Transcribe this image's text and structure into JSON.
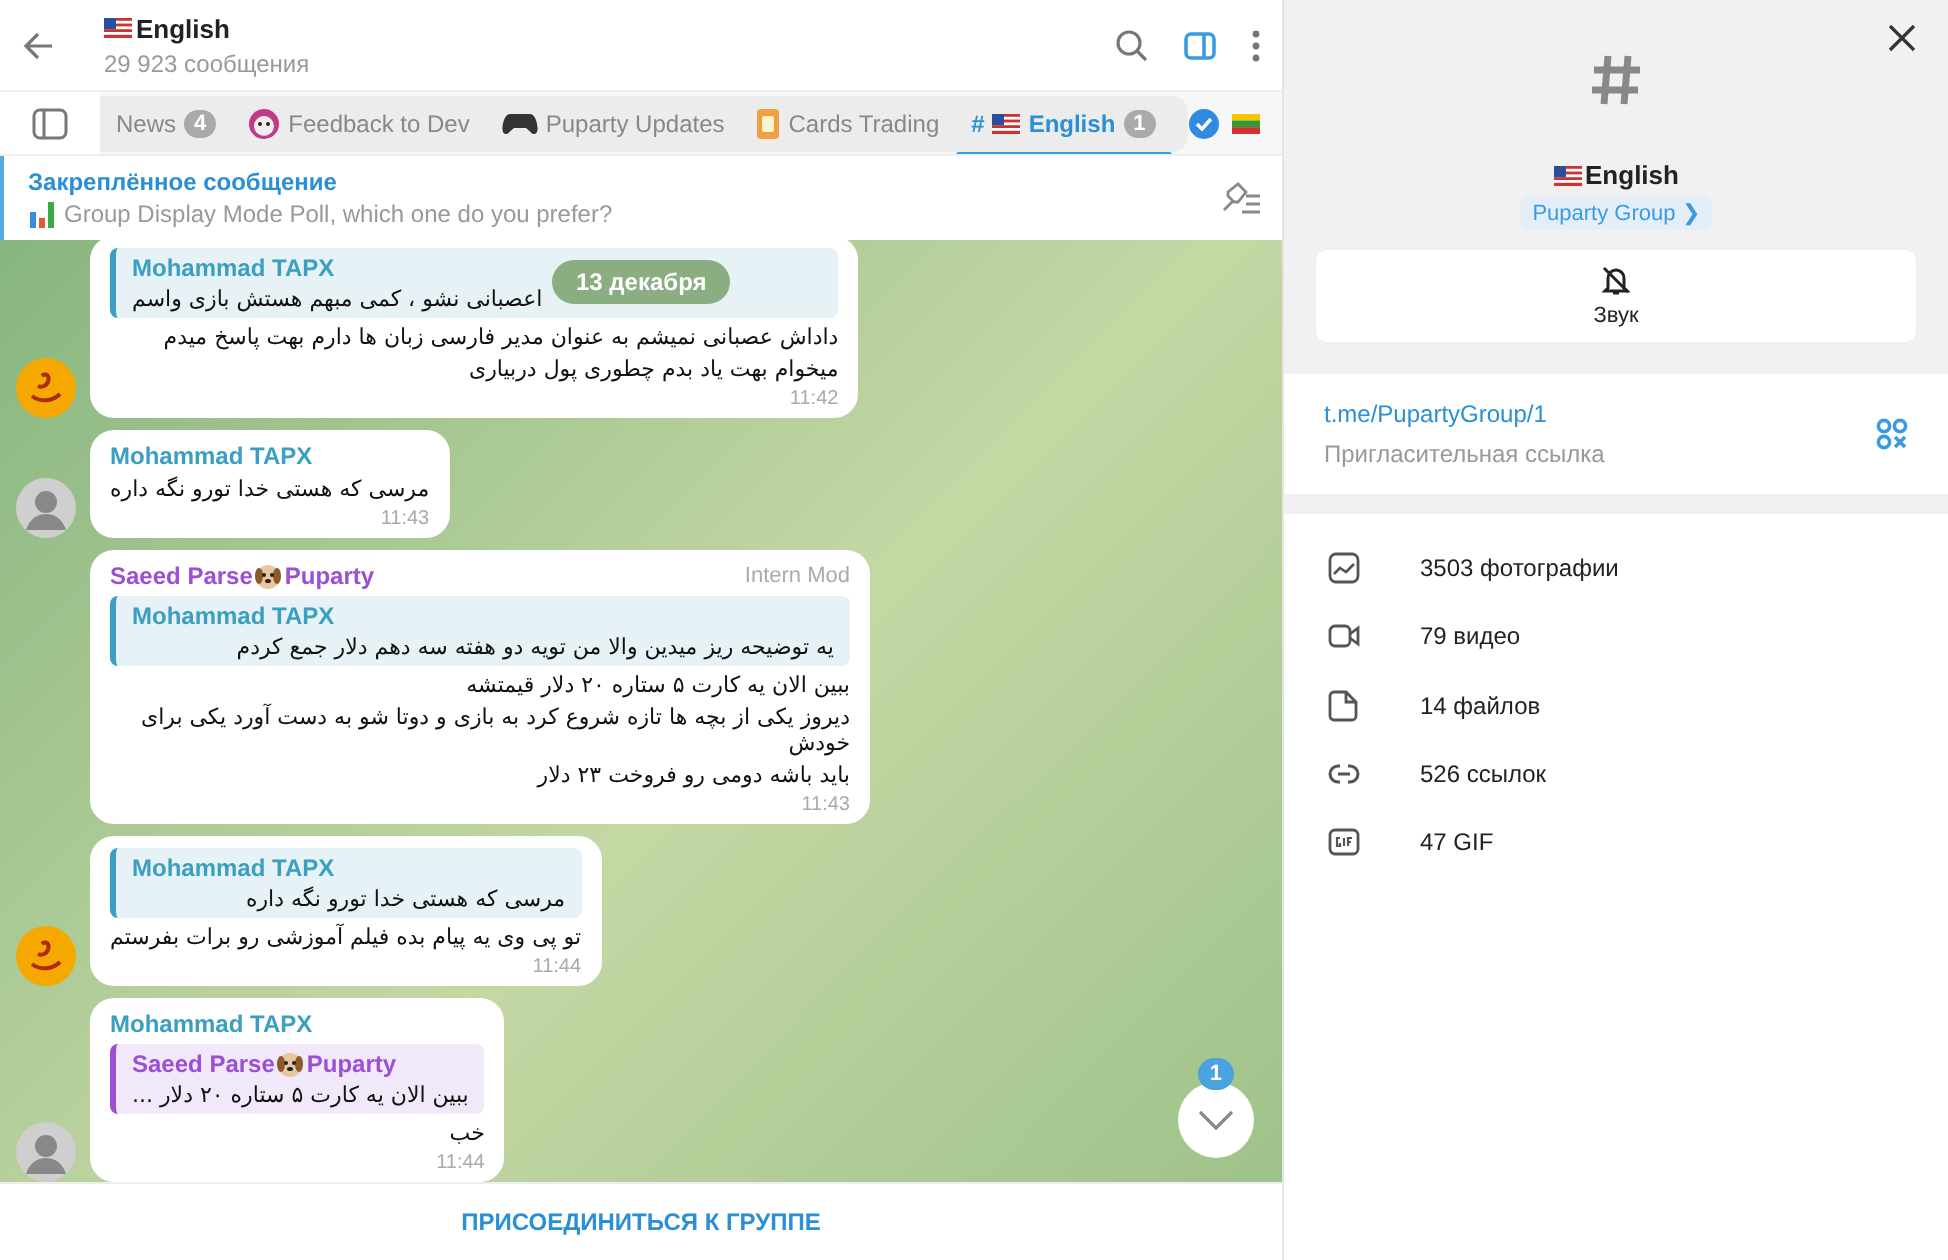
{
  "header": {
    "title": "English",
    "subtitle": "29 923 сообщения"
  },
  "tabs": [
    {
      "label": "News",
      "count": "4",
      "selected": false
    },
    {
      "label": "Feedback to Dev",
      "selected": false
    },
    {
      "label": "Puparty Updates",
      "selected": false
    },
    {
      "label": "Cards Trading",
      "selected": false
    },
    {
      "label": "English",
      "prefix": "#",
      "count": "1",
      "selected": true
    }
  ],
  "pinned": {
    "title": "Закреплённое сообщение",
    "text": "Group Display Mode Poll, which one do you prefer?"
  },
  "date_pill": "13 декабря",
  "messages": [
    {
      "avatar": true,
      "reply": {
        "sender": "Mohammad TAPX",
        "text": "اعصبانی نشو ، کمی مبهم هستش بازی واسم",
        "color": "#3a9fc0"
      },
      "lines": [
        "داداش عصبانی نمیشم به عنوان مدیر فارسی زبان ها دارم بهت پاسخ میدم",
        "میخوام بهت یاد بدم چطوری پول دربیاری"
      ],
      "time": "11:42"
    },
    {
      "avatar": true,
      "sender": {
        "name": "Mohammad TAPX",
        "color": "#3a9fc0"
      },
      "lines": [
        "مرسی که هستی خدا تورو نگه داره"
      ],
      "time": "11:43"
    },
    {
      "avatar": false,
      "sender": {
        "name": "Saeed Parse",
        "suffix": "Puparty",
        "color": "#9b4fd6"
      },
      "role": "Intern Mod",
      "reply": {
        "sender": "Mohammad TAPX",
        "text": "یه توضیحه ریز میدین والا من تویه دو هفته سه دهم دلار جمع کردم",
        "color": "#3a9fc0"
      },
      "lines": [
        "ببین الان یه کارت ۵ ستاره ۲۰ دلار قیمتشه",
        "دیروز یکی از بچه ها تازه شروع کرد به بازی و دوتا شو به دست آورد یکی برای خودش",
        "باید باشه دومی رو فروخت ۲۳ دلار"
      ],
      "time": "11:43"
    },
    {
      "avatar": true,
      "reply": {
        "sender": "Mohammad TAPX",
        "text": "مرسی که هستی خدا تورو نگه داره",
        "color": "#3a9fc0"
      },
      "lines": [
        "تو پی وی یه پیام بده فیلم آموزشی رو برات بفرستم"
      ],
      "time": "11:44"
    },
    {
      "avatar": true,
      "sender": {
        "name": "Mohammad TAPX",
        "color": "#3a9fc0"
      },
      "reply": {
        "sender": "Saeed Parse",
        "suffix": "Puparty",
        "text": "ببین الان یه کارت ۵ ستاره ۲۰ دلار ...",
        "color": "#9b4fd6"
      },
      "lines": [
        "خب"
      ],
      "time": "11:44"
    }
  ],
  "scroll_badge": "1",
  "join_button": "ПРИСОЕДИНИТЬСЯ К ГРУППЕ",
  "panel": {
    "name": "English",
    "group_link": "Puparty Group ❯",
    "mute_label": "Звук",
    "invite_link": "t.me/PupartyGroup/1",
    "invite_caption": "Пригласительная ссылка",
    "media": [
      {
        "kind": "photo",
        "label": "3503 фотографии"
      },
      {
        "kind": "video",
        "label": "79 видео"
      },
      {
        "kind": "file",
        "label": "14 файлов"
      },
      {
        "kind": "link",
        "label": "526 ссылок"
      },
      {
        "kind": "gif",
        "label": "47 GIF"
      }
    ]
  }
}
